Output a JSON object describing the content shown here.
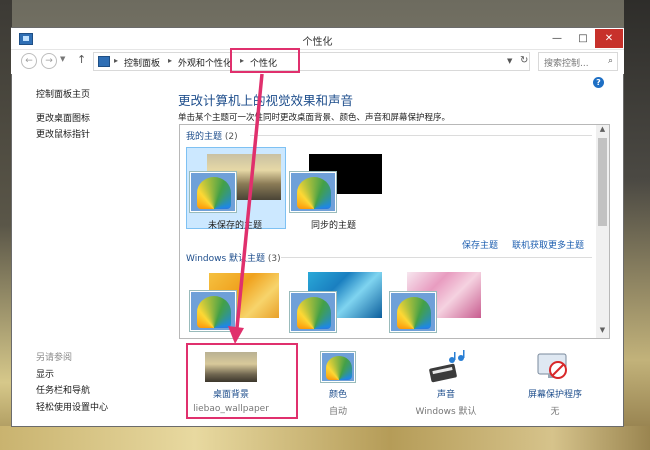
{
  "window": {
    "title": "个性化",
    "min_glyph": "—",
    "max_glyph": "□",
    "close_glyph": "✕"
  },
  "nav": {
    "back_glyph": "←",
    "forward_glyph": "→",
    "dropdown_glyph": "▼",
    "up_glyph": "↑",
    "breadcrumb": [
      "控制面板",
      "外观和个性化",
      "个性化"
    ],
    "sep_glyph": "▸",
    "refresh_glyph": "↻",
    "search_placeholder": "搜索控制...",
    "search_glyph": "⌕"
  },
  "help_glyph": "?",
  "sidebar": {
    "home": "控制面板主页",
    "links": [
      "更改桌面图标",
      "更改鼠标指针"
    ],
    "see_also_heading": "另请参阅",
    "see_also": [
      "显示",
      "任务栏和导航",
      "轻松使用设置中心"
    ]
  },
  "main": {
    "title": "更改计算机上的视觉效果和声音",
    "description": "单击某个主题可一次性同时更改桌面背景、颜色、声音和屏幕保护程序。"
  },
  "themes": {
    "my_group": {
      "label": "我的主题",
      "count": "(2)"
    },
    "my_items": [
      {
        "name": "未保存的主题",
        "selected": true
      },
      {
        "name": "同步的主题",
        "selected": false
      }
    ],
    "save_link": "保存主题",
    "online_link": "联机获取更多主题",
    "windows_group": {
      "label": "Windows 默认主题",
      "count": "(3)"
    },
    "scroll_up": "▲",
    "scroll_down": "▼"
  },
  "settings": [
    {
      "label": "桌面背景",
      "value": "liebao_wallpaper",
      "icon": "wallpaper-icon"
    },
    {
      "label": "颜色",
      "value": "自动",
      "icon": "color-icon"
    },
    {
      "label": "声音",
      "value": "Windows 默认",
      "icon": "sound-icon"
    },
    {
      "label": "屏幕保护程序",
      "value": "无",
      "icon": "screensaver-icon"
    }
  ],
  "colors": {
    "annotation": "#e0306d",
    "link": "#1e5fb0",
    "heading": "#1e4e8c",
    "selection": "#cce8ff",
    "close": "#c7312b"
  }
}
